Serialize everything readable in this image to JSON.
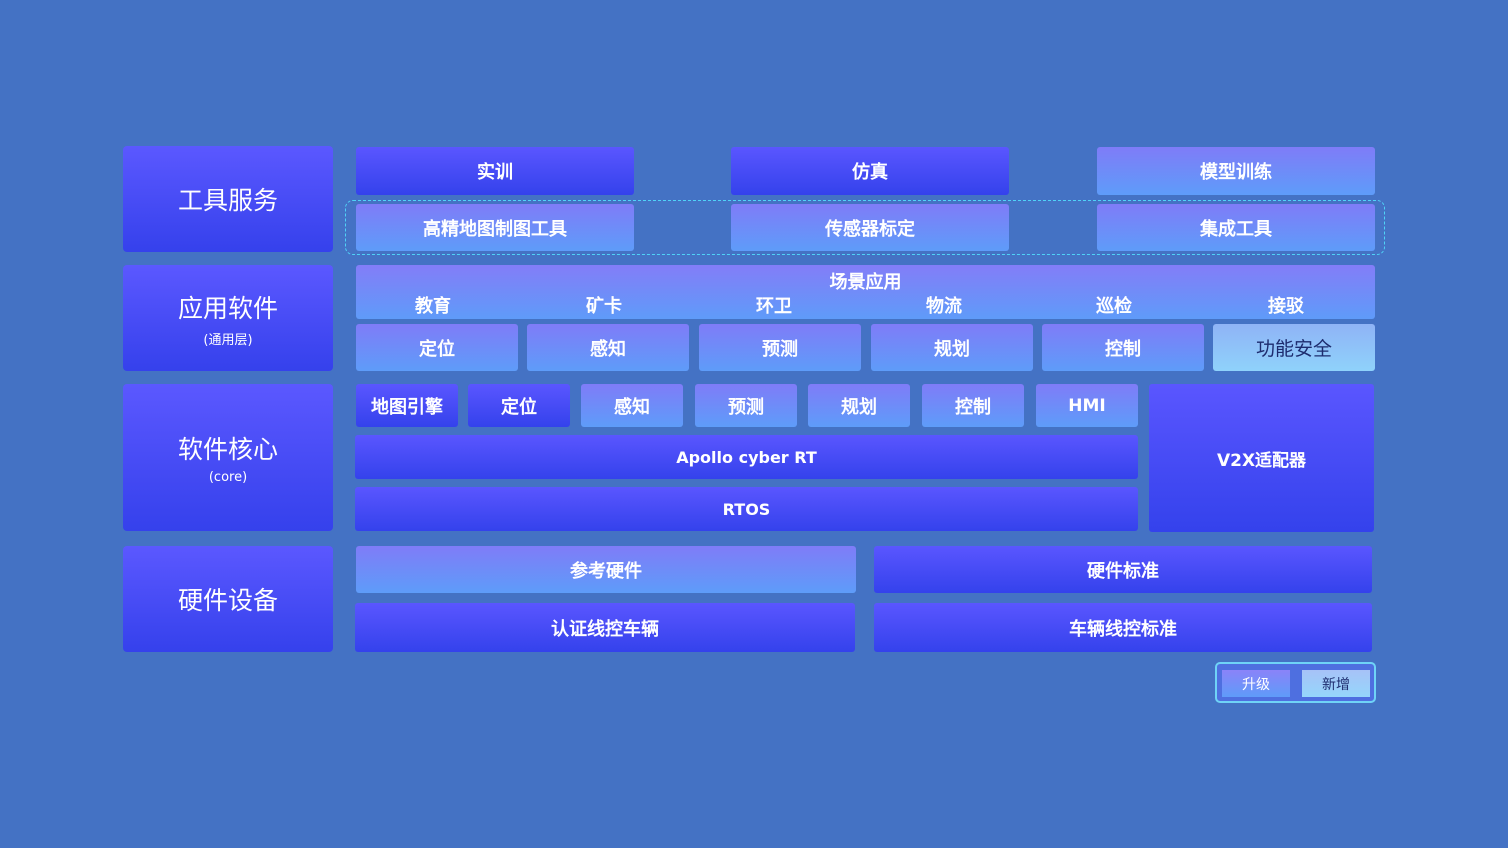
{
  "layers": {
    "tools": "工具服务",
    "apps": "应用软件",
    "apps_sub": "(通用层)",
    "core": "软件核心",
    "core_sub": "(core)",
    "hardware": "硬件设备"
  },
  "tools": {
    "row1": [
      "实训",
      "仿真",
      "模型训练"
    ],
    "row2": [
      "高精地图制图工具",
      "传感器标定",
      "集成工具"
    ]
  },
  "apps": {
    "scene_title": "场景应用",
    "scenes": [
      "教育",
      "矿卡",
      "环卫",
      "物流",
      "巡检",
      "接驳"
    ],
    "modules": [
      "定位",
      "感知",
      "预测",
      "规划",
      "控制",
      "功能安全"
    ]
  },
  "core": {
    "modules": [
      "地图引擎",
      "定位",
      "感知",
      "预测",
      "规划",
      "控制",
      "HMI"
    ],
    "runtime": "Apollo cyber RT",
    "os": "RTOS",
    "v2x": "V2X适配器"
  },
  "hardware": {
    "items": [
      "参考硬件",
      "硬件标准",
      "认证线控车辆",
      "车辆线控标准"
    ]
  },
  "legend": {
    "upgrade": "升级",
    "new": "新增"
  }
}
